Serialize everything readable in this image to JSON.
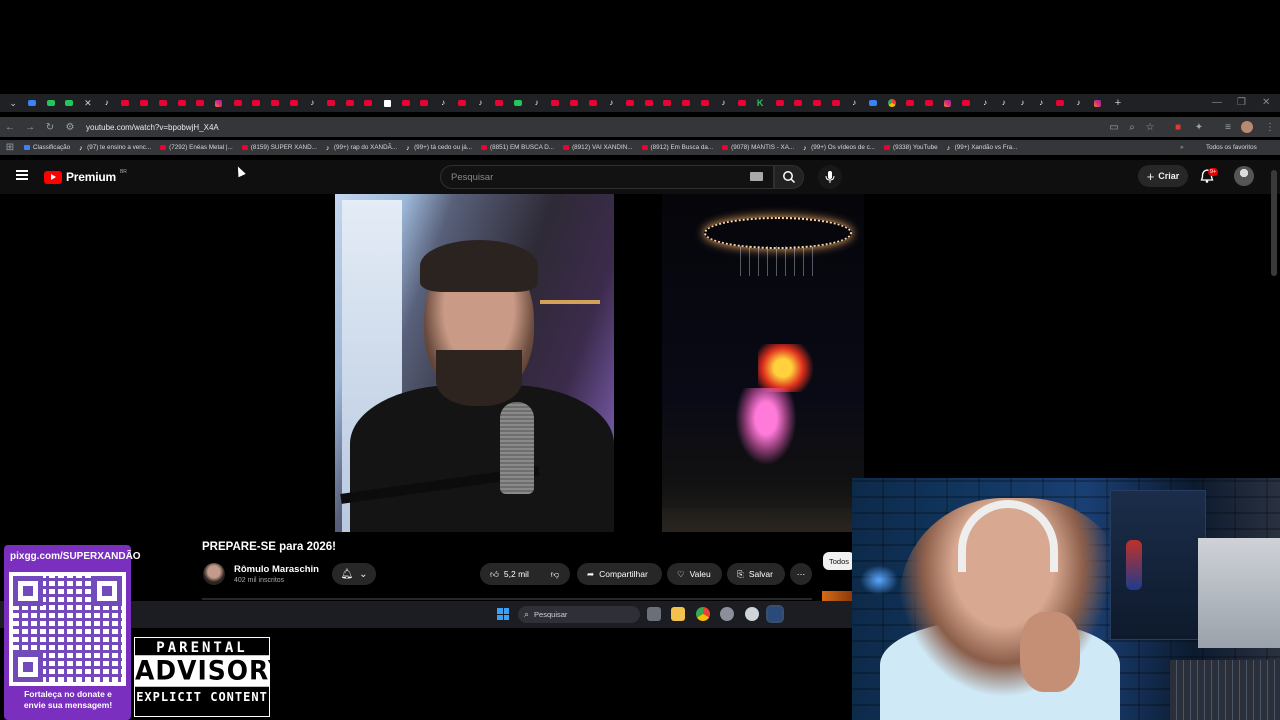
{
  "browser": {
    "url": "youtube.com/watch?v=bpobwjH_X4A",
    "bookmarks": [
      {
        "label": "Classificação",
        "icon": "blue"
      },
      {
        "label": "(97) te ensino a venc...",
        "icon": "tt"
      },
      {
        "label": "(7292) Enéas Metal |...",
        "icon": "yt"
      },
      {
        "label": "(8159) SUPER XAND...",
        "icon": "yt"
      },
      {
        "label": "(99+) rap do XANDÃ...",
        "icon": "tt"
      },
      {
        "label": "(99+) tá cedo ou já...",
        "icon": "tt"
      },
      {
        "label": "(8851) EM BUSCA D...",
        "icon": "yt"
      },
      {
        "label": "(8912) VAI XANDIN...",
        "icon": "yt"
      },
      {
        "label": "(8912) Em Busca da...",
        "icon": "yt"
      },
      {
        "label": "(9078) MANTIS - XA...",
        "icon": "yt"
      },
      {
        "label": "(99+) Os vídeos de c...",
        "icon": "tt"
      },
      {
        "label": "(9338) YouTube",
        "icon": "yt"
      },
      {
        "label": "(99+) Xandão vs Fra...",
        "icon": "tt"
      }
    ],
    "all_bookmarks": "Todos os favoritos"
  },
  "youtube": {
    "logo_text": "Premium",
    "logo_region": "BR",
    "search_placeholder": "Pesquisar",
    "create_label": "Criar",
    "notif_count": "9+"
  },
  "video": {
    "title": "PREPARE-SE para 2026!",
    "channel": "Rômulo Maraschin",
    "subscribers": "402 mil inscritos",
    "likes": "5,2 mil",
    "share": "Compartilhar",
    "thanks": "Valeu",
    "save": "Salvar",
    "chip_all": "Todos"
  },
  "taskbar": {
    "search_placeholder": "Pesquisar"
  },
  "overlay": {
    "qr_url": "pixgg.com/SUPERXANDÃO",
    "qr_caption_line1": "Fortaleça no donate e",
    "qr_caption_line2": "envie sua mensagem!",
    "advisory_top": "PARENTAL",
    "advisory_mid": "ADVISORY",
    "advisory_bot": "EXPLICIT CONTENT"
  },
  "colors": {
    "youtube_red": "#ff0000",
    "overlay_purple": "#7b2fbf",
    "yt_bg": "#0f0f0f"
  }
}
